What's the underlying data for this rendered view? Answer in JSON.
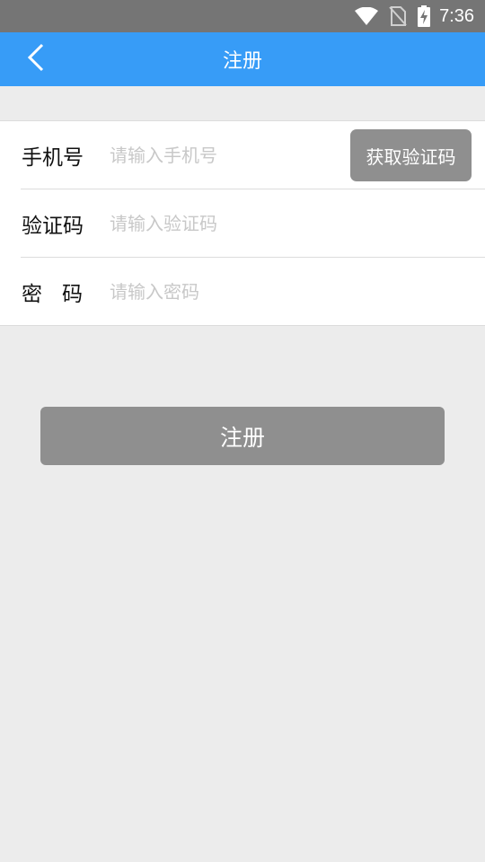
{
  "status_bar": {
    "time": "7:36",
    "icons": [
      "wifi-icon",
      "no-sim-icon",
      "battery-charging-icon"
    ]
  },
  "app_bar": {
    "title": "注册",
    "back_icon": "chevron-left-icon",
    "background": "#379cf7"
  },
  "form": {
    "phone": {
      "label": "手机号",
      "placeholder": "请输入手机号",
      "value": ""
    },
    "get_code_label": "获取验证码",
    "code": {
      "label": "验证码",
      "placeholder": "请输入验证码",
      "value": ""
    },
    "password": {
      "label": "密码",
      "placeholder": "请输入密码",
      "value": ""
    }
  },
  "register_button": {
    "label": "注册",
    "color": "#8f8f8f"
  }
}
